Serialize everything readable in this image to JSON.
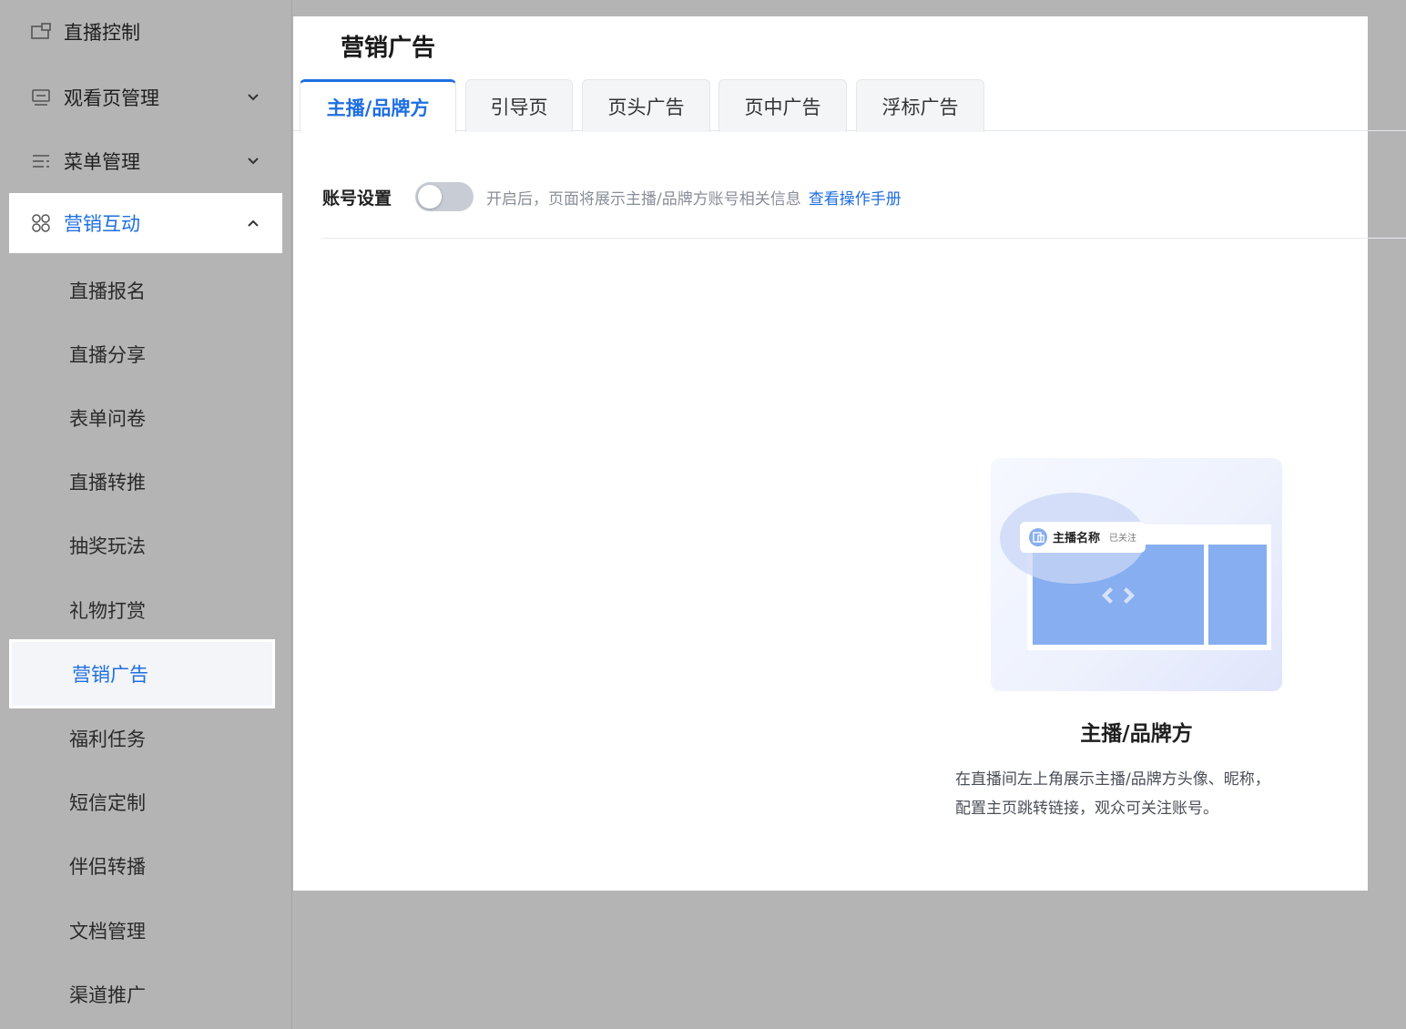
{
  "sidebar": {
    "items": [
      {
        "label": "直播控制",
        "icon": "screen-icon",
        "expandable": false
      },
      {
        "label": "观看页管理",
        "icon": "monitor-icon",
        "expandable": true
      },
      {
        "label": "菜单管理",
        "icon": "list-icon",
        "expandable": true
      },
      {
        "label": "营销互动",
        "icon": "command-icon",
        "expandable": true,
        "expanded": true
      }
    ],
    "sub_items": [
      "直播报名",
      "直播分享",
      "表单问卷",
      "直播转推",
      "抽奖玩法",
      "礼物打赏",
      "营销广告",
      "福利任务",
      "短信定制",
      "伴侣转播",
      "文档管理",
      "渠道推广"
    ],
    "active_sub_item": "营销广告"
  },
  "page": {
    "title": "营销广告",
    "tabs": [
      "主播/品牌方",
      "引导页",
      "页头广告",
      "页中广告",
      "浮标广告"
    ],
    "active_tab": "主播/品牌方"
  },
  "account_setting": {
    "label": "账号设置",
    "enabled": false,
    "description": "开启后，页面将展示主播/品牌方账号相关信息",
    "link": "查看操作手册"
  },
  "preview": {
    "bubble_name": "主播名称",
    "bubble_tag": "已关注",
    "title": "主播/品牌方",
    "description_line1": "在直播间左上角展示主播/品牌方头像、昵称，",
    "description_line2": "配置主页跳转链接，观众可关注账号。"
  },
  "colors": {
    "accent": "#1f6fe0",
    "background": "#b4b4b4",
    "panel": "#ffffff",
    "preview_block": "#86aef0"
  }
}
